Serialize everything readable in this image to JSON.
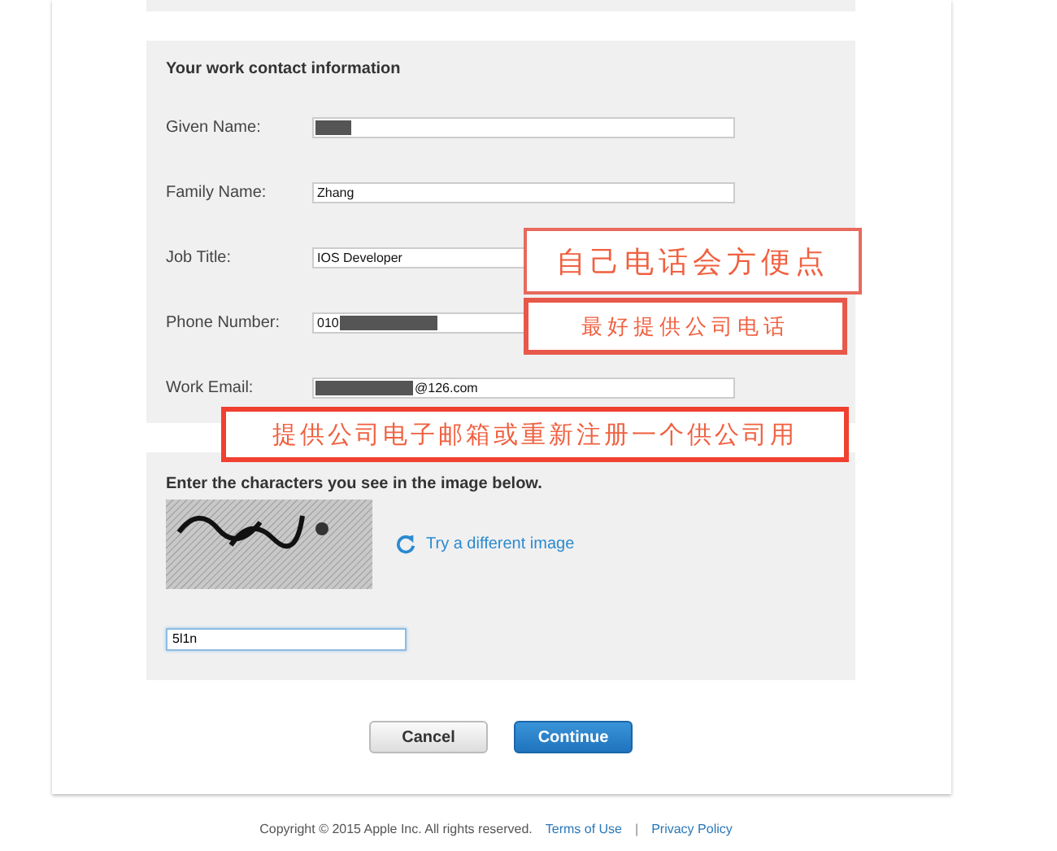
{
  "contact_section": {
    "title": "Your work contact information",
    "fields": [
      {
        "label": "Given Name:",
        "masked_before": true
      },
      {
        "label": "Family Name:",
        "value": "Zhang"
      },
      {
        "label": "Job Title:",
        "value": "IOS Developer"
      },
      {
        "label": "Phone Number:",
        "value": "010",
        "masked_after": true
      },
      {
        "label": "Work Email:",
        "value": "@126.com",
        "masked_before": true
      }
    ]
  },
  "captcha_section": {
    "instruction": "Enter the characters you see in the image below.",
    "refresh_link": "Try a different image",
    "input_value": "5l1n"
  },
  "buttons": [
    {
      "label": "Cancel",
      "kind": "secondary"
    },
    {
      "label": "Continue",
      "kind": "primary"
    }
  ],
  "footer": {
    "copyright": "Copyright © 2015 Apple Inc. All rights reserved.",
    "links": [
      "Terms of Use",
      "Privacy Policy"
    ],
    "separator": "|"
  },
  "annotations": [
    {
      "text": "自己电话会方便点",
      "kind": "large"
    },
    {
      "text": "最好提供公司电话",
      "kind": "small"
    },
    {
      "text": "提供公司电子邮箱或重新注册一个供公司用",
      "kind": "wide"
    }
  ]
}
